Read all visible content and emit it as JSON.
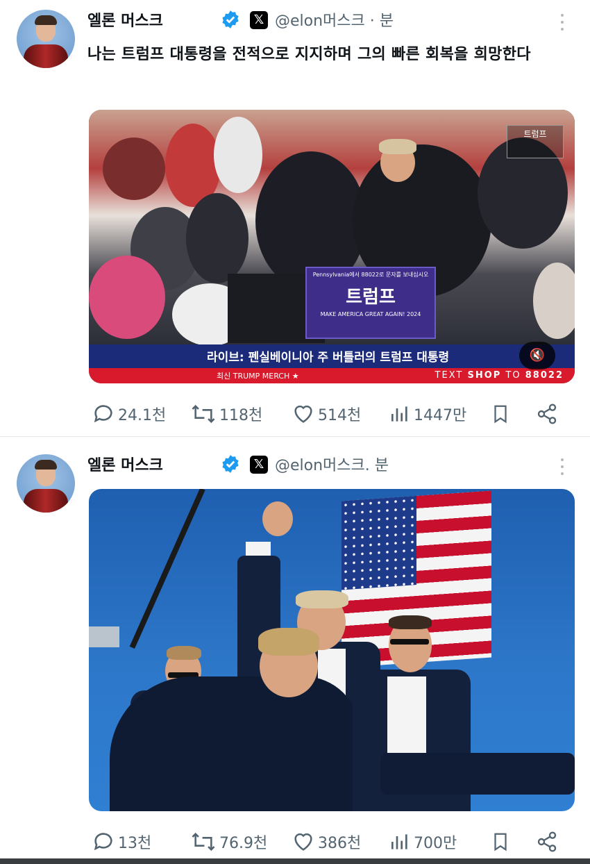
{
  "tweets": [
    {
      "author": "엘론 머스크",
      "handle": "@elon머스크 · 분",
      "text": "나는 트럼프 대통령을 전적으로 지지하며 그의 빠른 회복을 희망한다",
      "media": {
        "sign_text": "트럼프",
        "sign_small_top": "Pennsylvania에서 88022로 문자를 보내십시오",
        "sign_small_bottom": "MAKE AMERICA GREAT AGAIN! 2024",
        "corner_logo": "트럼프",
        "lower_third": "라이브: 펜실베이니아 주 버틀러의 트럼프 대통령",
        "ticker_left": "최신 TRUMP MERCH ★",
        "ticker_right_a": "TEXT",
        "ticker_right_b": "SHOP",
        "ticker_right_c": "TO",
        "ticker_right_d": "88022"
      },
      "stats": {
        "replies": "24.1천",
        "reposts": "118천",
        "likes": "514천",
        "views": "1447만"
      }
    },
    {
      "author": "엘론 머스크",
      "handle": "@elon머스크. 분",
      "stats": {
        "replies": "13천",
        "reposts": "76.9천",
        "likes": "386천",
        "views": "700만"
      }
    }
  ],
  "icons": {
    "verified": "verified-badge-icon",
    "x": "x-logo-icon",
    "reply": "reply-icon",
    "repost": "repost-icon",
    "like": "heart-icon",
    "views": "views-icon",
    "bookmark": "bookmark-icon",
    "share": "share-icon",
    "mute": "mute-icon"
  },
  "colors": {
    "verified": "#1d9bf0",
    "muted_text": "#536471",
    "ticker": "#d81a2c",
    "lower_third": "#1c2a7a"
  }
}
